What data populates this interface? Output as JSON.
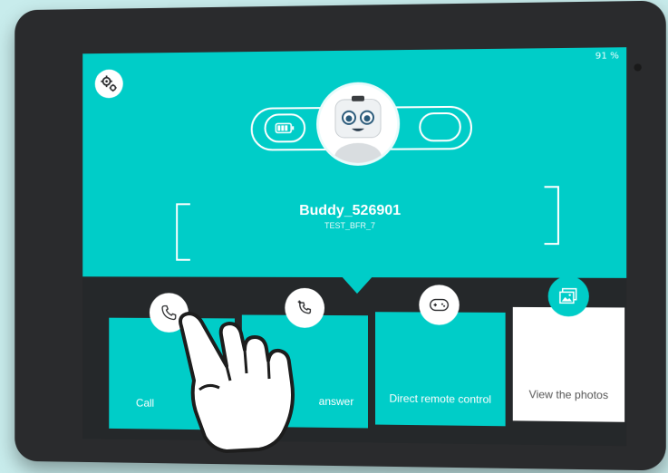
{
  "status": {
    "battery_percent": "91 %"
  },
  "robot": {
    "name": "Buddy_526901",
    "id": "TEST_BFR_7"
  },
  "tiles": [
    {
      "label": "Call",
      "icon": "phone-icon"
    },
    {
      "label": "Call with auto-answer",
      "visible_label": "answer",
      "icon": "phone-plus-icon"
    },
    {
      "label": "Direct remote control",
      "icon": "gamepad-icon"
    },
    {
      "label": "View the photos",
      "icon": "photos-icon"
    }
  ],
  "colors": {
    "accent": "#00cdc8",
    "band": "#25282a",
    "frame": "#2a2b2d"
  },
  "icons": {
    "settings": "gears-icon",
    "battery": "battery-icon",
    "toggle": "toggle-icon",
    "hand": "pointing-hand-icon"
  }
}
